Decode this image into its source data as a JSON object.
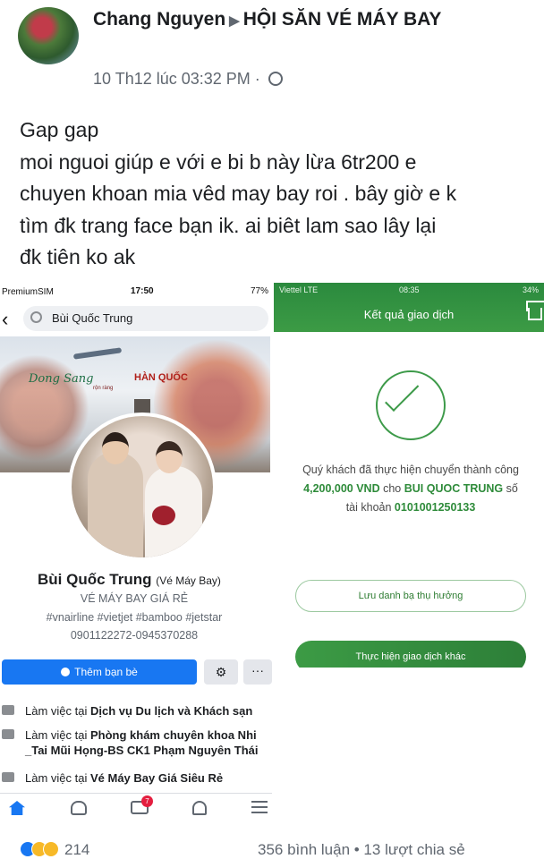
{
  "post": {
    "author": "Chang Nguyen",
    "group": "HỘI SĂN VÉ MÁY BAY",
    "timestamp": "10 Th12 lúc 03:32 PM",
    "separator": "·",
    "text_lines": [
      "Gap gap",
      "moi nguoi giúp e với e bi b này lừa 6tr200 e",
      "chuyen khoan mia vêd may bay roi . bây giờ e k",
      "tìm đk trang face bạn ik. ai biêt lam sao lây lại",
      "đk tiên ko ak"
    ],
    "icons": {
      "audience": "globe-icon",
      "arrow": "triangle-right-icon"
    }
  },
  "left_screenshot": {
    "status": {
      "carrier": "PremiumSIM",
      "time": "17:50",
      "battery": "77%"
    },
    "search_text": "Bùi Quốc Trung",
    "cover": {
      "script_text": "Dong Sang",
      "small_text": "rộn ràng",
      "brand_text": "HÀN QUỐC"
    },
    "profile_name": "Bùi Quốc Trung",
    "profile_nickname": "(Vé Máy Bay)",
    "bio_lines": [
      "VÉ MÁY BAY GIÁ RẺ",
      "#vnairline #vietjet #bamboo #jetstar",
      "0901122272-0945370288"
    ],
    "add_friend_label": "Thêm bạn bè",
    "more_label": "···",
    "work": [
      {
        "prefix": "Làm việc tại ",
        "place": "Dịch vụ Du lịch và Khách sạn"
      },
      {
        "prefix": "Làm việc tại ",
        "place": "Phòng khám chuyên khoa Nhi _Tai Mũi Họng-BS CK1 Phạm Nguyên Thái"
      },
      {
        "prefix": "Làm việc tại ",
        "place": "Vé Máy Bay Giá Siêu Rẻ"
      }
    ],
    "tabbar": {
      "watch_badge": "7"
    }
  },
  "right_screenshot": {
    "status": {
      "carrier": "Viettel LTE",
      "time": "08:35",
      "battery": "34%"
    },
    "title": "Kết quả giao dịch",
    "message": {
      "line1": "Quý khách đã thực hiện chuyển thành công",
      "amount": "4,200,000 VND",
      "for_text": " cho ",
      "recipient": "BUI QUOC TRUNG",
      "so_text": " số",
      "account_prefix": "tài khoản ",
      "account": "0101001250133"
    },
    "save_beneficiary_label": "Lưu danh bạ thụ hưởng",
    "new_transaction_label": "Thực hiện giao dịch khác",
    "colors": {
      "brand_green": "#3c9b45"
    }
  },
  "footer": {
    "reaction_count": "214",
    "comments_shares": "356 bình luận • 13 lượt chia sẻ"
  }
}
